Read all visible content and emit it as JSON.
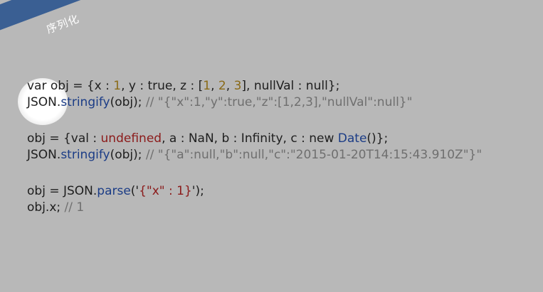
{
  "slide": {
    "title": "序列化",
    "colors": {
      "banner": "#3a5f93",
      "background": "#b8b8b8",
      "number": "#8a6a17",
      "keyword": "#8b1a1a",
      "function": "#1b3c86",
      "comment": "#6f6f6f"
    }
  },
  "code": {
    "l1": {
      "a": "var obj = {x : ",
      "n1": "1",
      "b": ", y : true, z : [",
      "n2": "1",
      "c": ", ",
      "n3": "2",
      "d": ", ",
      "n4": "3",
      "e": "], nullVal : null};"
    },
    "l2": {
      "a": "JSON.",
      "fn": "stringify",
      "b": "(obj); ",
      "cm": "// \"{\"x\":1,\"y\":true,\"z\":[1,2,3],\"nullVal\":null}\""
    },
    "l3": {
      "a": "obj = {val : ",
      "kw": "undefined",
      "b": ", a : NaN, b : Infinity, c : new ",
      "fn": "Date",
      "c": "()};"
    },
    "l4": {
      "a": "JSON.",
      "fn": "stringify",
      "b": "(obj); ",
      "cm": "// \"{\"a\":null,\"b\":null,\"c\":\"2015-01-20T14:15:43.910Z\"}\""
    },
    "l5": {
      "a": "obj = JSON.",
      "fn": "parse",
      "b": "('",
      "str": "{\"x\" : 1}",
      "c": "');"
    },
    "l6": {
      "a": "obj.x; ",
      "cm": "// 1"
    }
  }
}
